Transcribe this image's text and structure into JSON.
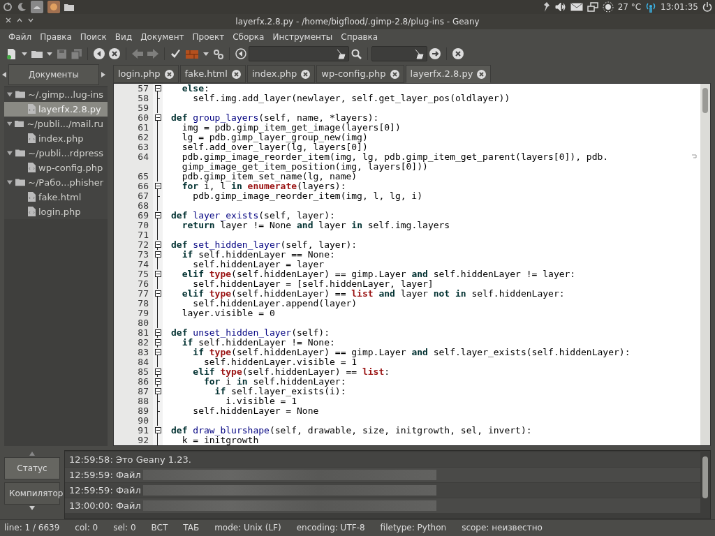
{
  "top_panel": {
    "temperature": "27 °C",
    "clock": "13:01:35"
  },
  "window": {
    "title": "layerfx.2.8.py - /home/bigflood/.gimp-2.8/plug-ins - Geany"
  },
  "menu": [
    "Файл",
    "Правка",
    "Поиск",
    "Вид",
    "Документ",
    "Проект",
    "Сборка",
    "Инструменты",
    "Справка"
  ],
  "toolbar": [
    {
      "kind": "new",
      "disabled": false
    },
    {
      "kind": "caret",
      "disabled": false
    },
    {
      "kind": "open",
      "disabled": false
    },
    {
      "kind": "caret",
      "disabled": false
    },
    {
      "kind": "save",
      "disabled": true
    },
    {
      "kind": "saveall",
      "disabled": true
    },
    {
      "kind": "sep"
    },
    {
      "kind": "revert",
      "disabled": false
    },
    {
      "kind": "close",
      "disabled": false
    },
    {
      "kind": "sep"
    },
    {
      "kind": "back",
      "disabled": true
    },
    {
      "kind": "forward",
      "disabled": true
    },
    {
      "kind": "sep"
    },
    {
      "kind": "compile",
      "disabled": false
    },
    {
      "kind": "build",
      "disabled": false
    },
    {
      "kind": "caret",
      "disabled": false
    },
    {
      "kind": "run",
      "disabled": false
    },
    {
      "kind": "sep"
    },
    {
      "kind": "color",
      "disabled": false
    },
    {
      "kind": "search",
      "disabled": false
    },
    {
      "kind": "goto",
      "disabled": false
    },
    {
      "kind": "sep"
    },
    {
      "kind": "quit",
      "disabled": false
    }
  ],
  "sidebar": {
    "tab": "Документы",
    "tree": [
      {
        "label": "~/.gimp...lug-ins",
        "expanded": true,
        "children": [
          {
            "label": "layerfx.2.8.py",
            "selected": true
          }
        ]
      },
      {
        "label": "~/publi.../mail.ru",
        "expanded": true,
        "children": [
          {
            "label": "index.php",
            "selected": false
          }
        ]
      },
      {
        "label": "~/publi...rdpress",
        "expanded": true,
        "children": [
          {
            "label": "wp-config.php",
            "selected": false
          }
        ]
      },
      {
        "label": "~/Рабо...phisher",
        "expanded": true,
        "children": [
          {
            "label": "fake.html",
            "selected": false
          },
          {
            "label": "login.php",
            "selected": false
          }
        ]
      }
    ]
  },
  "tabs": [
    {
      "label": "login.php",
      "selected": false
    },
    {
      "label": "fake.html",
      "selected": false
    },
    {
      "label": "index.php",
      "selected": false
    },
    {
      "label": "wp-config.php",
      "selected": false
    },
    {
      "label": "layerfx.2.8.py",
      "selected": true
    }
  ],
  "code": [
    {
      "no": "57",
      "kind": "fold-start",
      "tokens": [
        {
          "kind": "keyword",
          "text": "  else"
        },
        {
          "kind": "plain",
          "text": ":"
        }
      ]
    },
    {
      "no": "58",
      "kind": "fold-end",
      "tokens": [
        {
          "kind": "plain",
          "text": "    self.img.add_layer(newlayer, self.get_layer_pos(oldlayer))"
        }
      ]
    },
    {
      "no": "59",
      "kind": "body"
    },
    {
      "no": "60",
      "kind": "fold-start",
      "tokens": [
        {
          "kind": "keyword",
          "text": "def"
        },
        {
          "kind": "function",
          "text": " group_layers"
        },
        {
          "kind": "plain",
          "text": "(self, name, *layers):"
        }
      ]
    },
    {
      "no": "61",
      "kind": "body",
      "tokens": [
        {
          "kind": "plain",
          "text": "  img = pdb.gimp_item_get_image(layers[0])"
        }
      ]
    },
    {
      "no": "62",
      "kind": "body",
      "tokens": [
        {
          "kind": "plain",
          "text": "  lg = pdb.gimp_layer_group_new(img)"
        }
      ]
    },
    {
      "no": "63",
      "kind": "body",
      "tokens": [
        {
          "kind": "plain",
          "text": "  self.add_over_layer(lg, layers[0])"
        }
      ]
    },
    {
      "no": "64",
      "kind": "body",
      "tokens": [
        {
          "kind": "plain",
          "text": "  pdb.gimp_image_reorder_item(img, lg, pdb.gimp_item_get_parent(layers[0]), pdb."
        }
      ]
    },
    {
      "kind": "body",
      "tokens": [
        {
          "kind": "plain",
          "text": "  gimp_image_get_item_position(img, layers[0]))"
        }
      ]
    },
    {
      "no": "65",
      "kind": "body",
      "tokens": [
        {
          "kind": "plain",
          "text": "  pdb.gimp_item_set_name(lg, name)"
        }
      ]
    },
    {
      "no": "66",
      "kind": "fold-start",
      "tokens": [
        {
          "kind": "keyword",
          "text": "  for"
        },
        {
          "kind": "plain",
          "text": " i, l "
        },
        {
          "kind": "keyword",
          "text": "in"
        },
        {
          "kind": "builtin",
          "text": " enumerate"
        },
        {
          "kind": "plain",
          "text": "(layers):"
        }
      ]
    },
    {
      "no": "67",
      "kind": "fold-end",
      "tokens": [
        {
          "kind": "plain",
          "text": "    pdb.gimp_image_reorder_item(img, l, lg, i)"
        }
      ]
    },
    {
      "no": "68",
      "kind": "body"
    },
    {
      "no": "69",
      "kind": "fold-start",
      "tokens": [
        {
          "kind": "keyword",
          "text": "def"
        },
        {
          "kind": "function",
          "text": " layer_exists"
        },
        {
          "kind": "plain",
          "text": "(self, layer):"
        }
      ]
    },
    {
      "no": "70",
      "kind": "body",
      "tokens": [
        {
          "kind": "keyword",
          "text": "  return"
        },
        {
          "kind": "plain",
          "text": " layer != None "
        },
        {
          "kind": "keyword",
          "text": "and"
        },
        {
          "kind": "plain",
          "text": " layer "
        },
        {
          "kind": "keyword",
          "text": "in"
        },
        {
          "kind": "plain",
          "text": " self.img.layers"
        }
      ]
    },
    {
      "no": "71",
      "kind": "body"
    },
    {
      "no": "72",
      "kind": "fold-start",
      "tokens": [
        {
          "kind": "keyword",
          "text": "def"
        },
        {
          "kind": "function",
          "text": " set_hidden_layer"
        },
        {
          "kind": "plain",
          "text": "(self, layer):"
        }
      ]
    },
    {
      "no": "73",
      "kind": "fold-start",
      "tokens": [
        {
          "kind": "keyword",
          "text": "  if"
        },
        {
          "kind": "plain",
          "text": " self.hiddenLayer == None:"
        }
      ]
    },
    {
      "no": "74",
      "kind": "body",
      "tokens": [
        {
          "kind": "plain",
          "text": "    self.hiddenLayer = layer"
        }
      ]
    },
    {
      "no": "75",
      "kind": "fold-start",
      "tokens": [
        {
          "kind": "keyword",
          "text": "  elif"
        },
        {
          "kind": "builtin",
          "text": " type"
        },
        {
          "kind": "plain",
          "text": "(self.hiddenLayer) == gimp.Layer "
        },
        {
          "kind": "keyword",
          "text": "and"
        },
        {
          "kind": "plain",
          "text": " self.hiddenLayer != layer:"
        }
      ]
    },
    {
      "no": "76",
      "kind": "body",
      "tokens": [
        {
          "kind": "plain",
          "text": "    self.hiddenLayer = [self.hiddenLayer, layer]"
        }
      ]
    },
    {
      "no": "77",
      "kind": "fold-start",
      "tokens": [
        {
          "kind": "keyword",
          "text": "  elif"
        },
        {
          "kind": "builtin",
          "text": " type"
        },
        {
          "kind": "plain",
          "text": "(self.hiddenLayer) == "
        },
        {
          "kind": "builtin",
          "text": "list"
        },
        {
          "kind": "keyword",
          "text": " and"
        },
        {
          "kind": "plain",
          "text": " layer "
        },
        {
          "kind": "keyword",
          "text": "not"
        },
        {
          "kind": "keyword",
          "text": " in"
        },
        {
          "kind": "plain",
          "text": " self.hiddenLayer:"
        }
      ]
    },
    {
      "no": "78",
      "kind": "body",
      "tokens": [
        {
          "kind": "plain",
          "text": "    self.hiddenLayer.append(layer)"
        }
      ]
    },
    {
      "no": "79",
      "kind": "body",
      "tokens": [
        {
          "kind": "plain",
          "text": "  layer.visible = 0"
        }
      ]
    },
    {
      "no": "80",
      "kind": "body"
    },
    {
      "no": "81",
      "kind": "fold-start",
      "tokens": [
        {
          "kind": "keyword",
          "text": "def"
        },
        {
          "kind": "function",
          "text": " unset_hidden_layer"
        },
        {
          "kind": "plain",
          "text": "(self):"
        }
      ]
    },
    {
      "no": "82",
      "kind": "fold-start",
      "tokens": [
        {
          "kind": "keyword",
          "text": "  if"
        },
        {
          "kind": "plain",
          "text": " self.hiddenLayer != None:"
        }
      ]
    },
    {
      "no": "83",
      "kind": "fold-start",
      "tokens": [
        {
          "kind": "keyword",
          "text": "    if"
        },
        {
          "kind": "builtin",
          "text": " type"
        },
        {
          "kind": "plain",
          "text": "(self.hiddenLayer) == gimp.Layer "
        },
        {
          "kind": "keyword",
          "text": "and"
        },
        {
          "kind": "plain",
          "text": " self.layer_exists(self.hiddenLayer):"
        }
      ]
    },
    {
      "no": "84",
      "kind": "body",
      "tokens": [
        {
          "kind": "plain",
          "text": "      self.hiddenLayer.visible = 1"
        }
      ]
    },
    {
      "no": "85",
      "kind": "fold-start",
      "tokens": [
        {
          "kind": "keyword",
          "text": "    elif"
        },
        {
          "kind": "builtin",
          "text": " type"
        },
        {
          "kind": "plain",
          "text": "(self.hiddenLayer) == "
        },
        {
          "kind": "builtin",
          "text": "list"
        },
        {
          "kind": "plain",
          "text": ":"
        }
      ]
    },
    {
      "no": "86",
      "kind": "fold-start",
      "tokens": [
        {
          "kind": "keyword",
          "text": "      for"
        },
        {
          "kind": "plain",
          "text": " i "
        },
        {
          "kind": "keyword",
          "text": "in"
        },
        {
          "kind": "plain",
          "text": " self.hiddenLayer:"
        }
      ]
    },
    {
      "no": "87",
      "kind": "fold-start",
      "tokens": [
        {
          "kind": "keyword",
          "text": "        if"
        },
        {
          "kind": "plain",
          "text": " self.layer_exists(i):"
        }
      ]
    },
    {
      "no": "88",
      "kind": "fold-end",
      "tokens": [
        {
          "kind": "plain",
          "text": "          i.visible = 1"
        }
      ]
    },
    {
      "no": "89",
      "kind": "fold-end",
      "tokens": [
        {
          "kind": "plain",
          "text": "    self.hiddenLayer = None"
        }
      ]
    },
    {
      "no": "90",
      "kind": "body"
    },
    {
      "no": "91",
      "kind": "fold-start",
      "tokens": [
        {
          "kind": "keyword",
          "text": "def"
        },
        {
          "kind": "function",
          "text": " draw_blurshape"
        },
        {
          "kind": "plain",
          "text": "(self, drawable, size, initgrowth, sel, invert):"
        }
      ]
    },
    {
      "no": "92",
      "kind": "body",
      "tokens": [
        {
          "kind": "plain",
          "text": "  k = initgrowth"
        }
      ]
    }
  ],
  "message_tabs": [
    {
      "label": "Статус",
      "selected": true
    },
    {
      "label": "Компилятор",
      "selected": false
    }
  ],
  "messages": [
    {
      "text": "12:59:58: Это Geany 1.23.",
      "redacted": false
    },
    {
      "text": "12:59:59: Файл",
      "redacted": true
    },
    {
      "text": "12:59:59: Файл",
      "redacted": true
    },
    {
      "text": "13:00:00: Файл",
      "redacted": true
    }
  ],
  "status_bar": [
    "line: 1 / 6639",
    "col: 0",
    "sel: 0",
    "BCT",
    "TAБ",
    "mode: Unix (LF)",
    "encoding: UTF-8",
    "filetype: Python",
    "scope: неизвестно"
  ]
}
